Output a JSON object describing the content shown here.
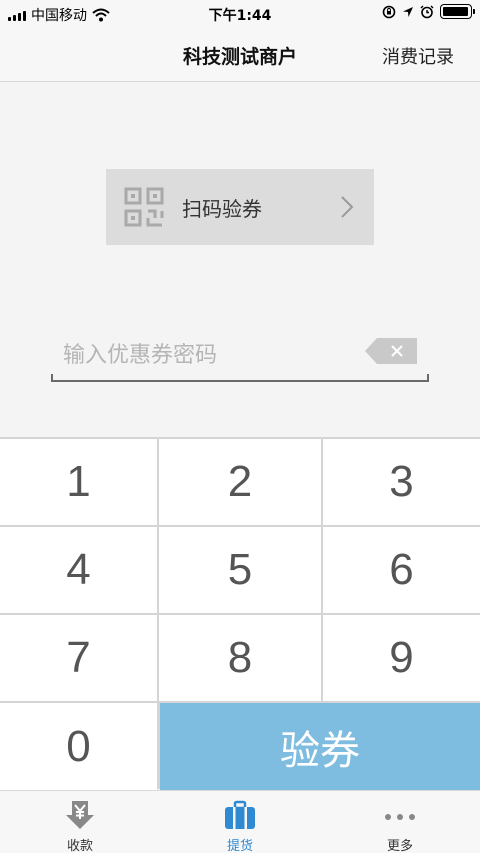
{
  "status_bar": {
    "carrier": "中国移动",
    "time": "下午1:44",
    "battery_level": 0.95,
    "icons": [
      "signal-icon",
      "wifi-icon",
      "rotation-lock-icon",
      "location-icon",
      "alarm-icon",
      "battery-icon"
    ]
  },
  "nav": {
    "title": "科技测试商户",
    "action_label": "消费记录"
  },
  "scan": {
    "label": "扫码验券",
    "icon": "qr-code-icon"
  },
  "coupon": {
    "value": "",
    "placeholder": "输入优惠券密码",
    "clear_icon": "backspace-icon"
  },
  "keypad": {
    "keys": [
      "1",
      "2",
      "3",
      "4",
      "5",
      "6",
      "7",
      "8",
      "9",
      "0"
    ],
    "confirm_label": "验券"
  },
  "tabs": [
    {
      "label": "收款",
      "icon": "yen-download-icon",
      "active": false
    },
    {
      "label": "提货",
      "icon": "suitcase-icon",
      "active": true
    },
    {
      "label": "更多",
      "icon": "more-dots-icon",
      "active": false
    }
  ],
  "colors": {
    "accent": "#2f8ad1",
    "confirm_bg": "#7fbde0",
    "scan_bg": "#dcdcdc",
    "page_bg": "#f4f4f4"
  }
}
